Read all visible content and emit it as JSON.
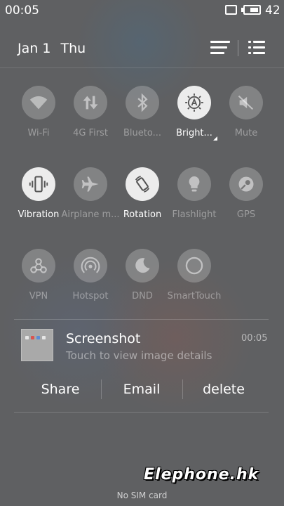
{
  "status_bar": {
    "time": "00:05",
    "battery_level": "42"
  },
  "header": {
    "date": "Jan 1",
    "day": "Thu"
  },
  "quick_settings": [
    {
      "label": "Wi-Fi",
      "icon": "wifi-icon",
      "active": false
    },
    {
      "label": "4G First",
      "icon": "data-arrows-icon",
      "active": false
    },
    {
      "label": "Blueto...",
      "icon": "bluetooth-icon",
      "active": false
    },
    {
      "label": "Bright...",
      "icon": "brightness-auto-icon",
      "active": true
    },
    {
      "label": "Mute",
      "icon": "mute-icon",
      "active": false
    },
    {
      "label": "Vibration",
      "icon": "vibration-icon",
      "active": true
    },
    {
      "label": "Airplane m...",
      "icon": "airplane-icon",
      "active": false
    },
    {
      "label": "Rotation",
      "icon": "rotation-icon",
      "active": true
    },
    {
      "label": "Flashlight",
      "icon": "flashlight-icon",
      "active": false
    },
    {
      "label": "GPS",
      "icon": "gps-icon",
      "active": false
    },
    {
      "label": "VPN",
      "icon": "vpn-icon",
      "active": false
    },
    {
      "label": "Hotspot",
      "icon": "hotspot-icon",
      "active": false
    },
    {
      "label": "DND",
      "icon": "moon-icon",
      "active": false
    },
    {
      "label": "SmartTouch",
      "icon": "smarttouch-icon",
      "active": false
    }
  ],
  "notification": {
    "title": "Screenshot",
    "subtitle": "Touch to view image details",
    "time": "00:05",
    "actions": [
      "Share",
      "Email",
      "delete"
    ]
  },
  "watermark": "Elephone.hk",
  "footer": "No SIM card",
  "colors": {
    "active_tile": "#ececec",
    "inactive_tile": "rgba(255,255,255,0.22)",
    "background": "#5f6062"
  }
}
